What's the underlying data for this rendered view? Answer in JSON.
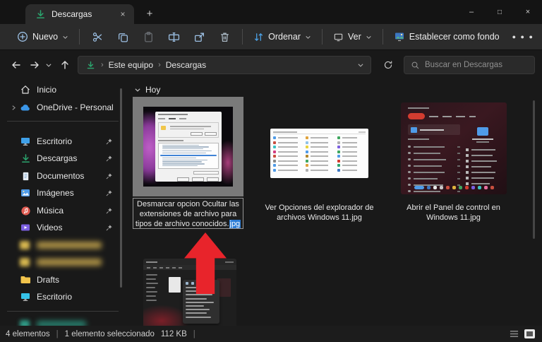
{
  "colors": {
    "accent_green": "#2ba56e",
    "selection_blue": "#2b7cd6",
    "arrow_red": "#e8242b",
    "toolbar_icon_blue": "#9cc0e4"
  },
  "icons": {
    "tab": "download-arrow",
    "search": "magnifier",
    "sort": "up-down-arrows",
    "view": "monitor",
    "wallpaper": "picture-on-desktop"
  },
  "window": {
    "tab_title": "Descargas",
    "tab_close": "×",
    "new_tab": "+",
    "minimize": "–",
    "maximize": "□",
    "close": "×"
  },
  "toolbar": {
    "new_label": "Nuevo",
    "sort_label": "Ordenar",
    "view_label": "Ver",
    "wallpaper_label": "Establecer como fondo",
    "more": "● ● ●"
  },
  "addressbar": {
    "crumb_device": "Este equipo",
    "crumb_folder": "Descargas",
    "crumb_sep": "›",
    "search_placeholder": "Buscar en Descargas"
  },
  "sidebar": {
    "items": [
      {
        "label": "Inicio"
      },
      {
        "label": "OneDrive - Personal"
      },
      {
        "label": "Escritorio"
      },
      {
        "label": "Descargas"
      },
      {
        "label": "Documentos"
      },
      {
        "label": "Imágenes"
      },
      {
        "label": "Música"
      },
      {
        "label": "Videos"
      },
      {
        "label": "Drafts"
      },
      {
        "label": "Escritorio"
      }
    ]
  },
  "main": {
    "group_label": "Hoy",
    "files": [
      {
        "name": "Desmarcar opcion Ocultar las extensiones de archivo para tipos de archivo conocidos.",
        "ext": "jpg"
      },
      {
        "name": "Ver Opciones del explorador de archivos Windows 11.jpg"
      },
      {
        "name": "Abrir el Panel de control en Windows 11.jpg"
      }
    ]
  },
  "statusbar": {
    "count": "4 elementos",
    "sep": "|",
    "selected": "1 elemento seleccionado",
    "size": "112 KB"
  }
}
